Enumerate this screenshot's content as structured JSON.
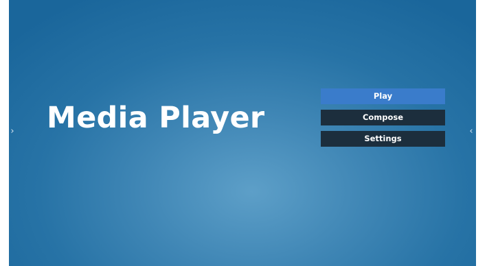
{
  "app": {
    "title": "Media Player"
  },
  "menu": {
    "items": [
      {
        "label": "Play",
        "active": true
      },
      {
        "label": "Compose",
        "active": false
      },
      {
        "label": "Settings",
        "active": false
      }
    ]
  },
  "nav": {
    "left_icon": "chevron-right-icon",
    "left_glyph": "›",
    "right_icon": "chevron-left-icon",
    "right_glyph": "‹"
  },
  "colors": {
    "background": "#2773a6",
    "button_active": "#3a7ccb",
    "button_default": "#1c2e3d",
    "text": "#ffffff"
  }
}
